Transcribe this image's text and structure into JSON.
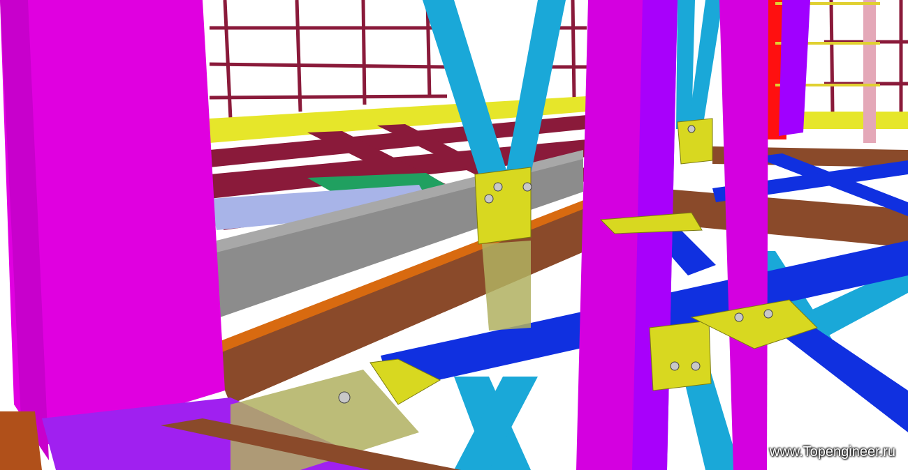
{
  "scene": {
    "subject": "3D steel frame model render",
    "colors": {
      "background": "#ffffff",
      "column_magenta": "#e000e0",
      "column_violet": "#a000ff",
      "brace_cyan": "#1aa8d8",
      "beam_blue": "#1030e0",
      "beam_brown": "#8a4a2a",
      "beam_maroon": "#8a1a3a",
      "beam_gray": "#8a8a8a",
      "plate_yellow": "#d8d820",
      "plate_olive": "#b0b060",
      "rail_red": "#ff0000",
      "rail_pink": "#e0a0b0",
      "green_deck": "#20a060"
    }
  },
  "watermark": {
    "text": "www.Topengineer.ru"
  }
}
